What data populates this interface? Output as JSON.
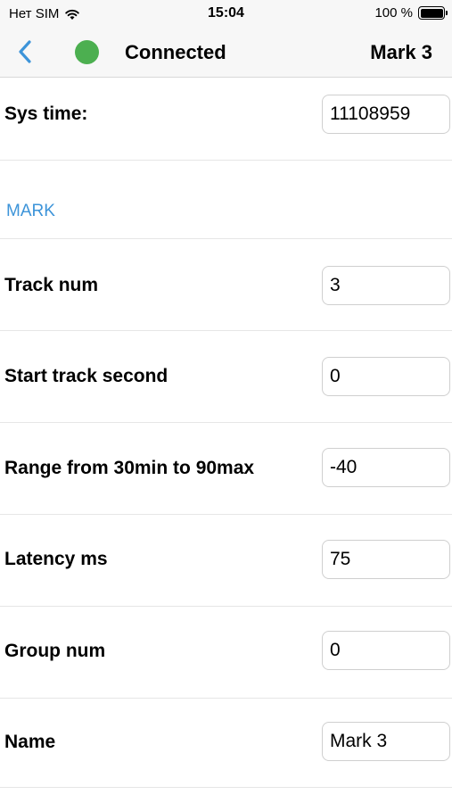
{
  "status_bar": {
    "carrier": "Нет SIM",
    "time": "15:04",
    "battery": "100 %"
  },
  "nav": {
    "status": "Connected",
    "title": "Mark 3",
    "status_color": "#4caf50",
    "accent": "#3d94d9"
  },
  "sys_time": {
    "label": "Sys time:",
    "value": "11108959"
  },
  "section": {
    "title": "MARK"
  },
  "fields": [
    {
      "label": "Track num",
      "value": "3"
    },
    {
      "label": "Start track second",
      "value": "0"
    },
    {
      "label": "Range from 30min to 90max",
      "value": "-40"
    },
    {
      "label": "Latency ms",
      "value": "75"
    },
    {
      "label": "Group num",
      "value": "0"
    },
    {
      "label": "Name",
      "value": "Mark 3"
    }
  ]
}
